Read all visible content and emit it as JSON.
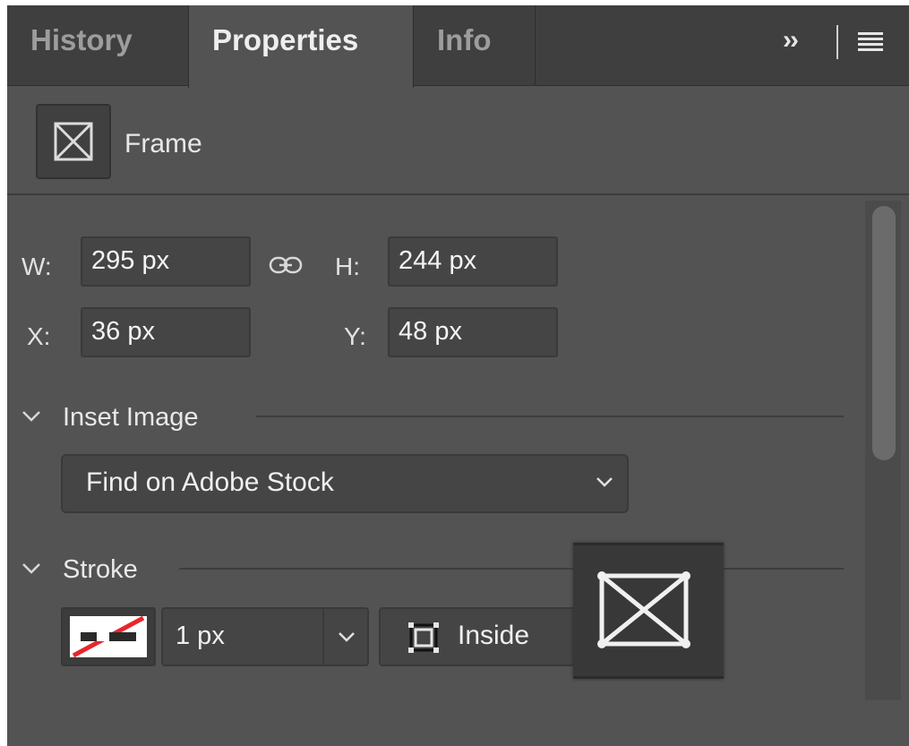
{
  "tabs": {
    "history": "History",
    "properties": "Properties",
    "info": "Info",
    "overflow": "››"
  },
  "header": {
    "title": "Frame",
    "icon": "frame-icon"
  },
  "transform": {
    "w_label": "W:",
    "w_value": "295 px",
    "h_label": "H:",
    "h_value": "244 px",
    "x_label": "X:",
    "x_value": "36 px",
    "y_label": "Y:",
    "y_value": "48 px"
  },
  "inset_image": {
    "title": "Inset Image",
    "dropdown": "Find on Adobe Stock"
  },
  "stroke": {
    "title": "Stroke",
    "width": "1 px",
    "alignment": "Inside"
  },
  "colors": {
    "panel_bg": "#535353",
    "tabbar_bg": "#3f3f3f",
    "field_bg": "#454545",
    "stroke_swatch_accent": "#e8262b"
  }
}
